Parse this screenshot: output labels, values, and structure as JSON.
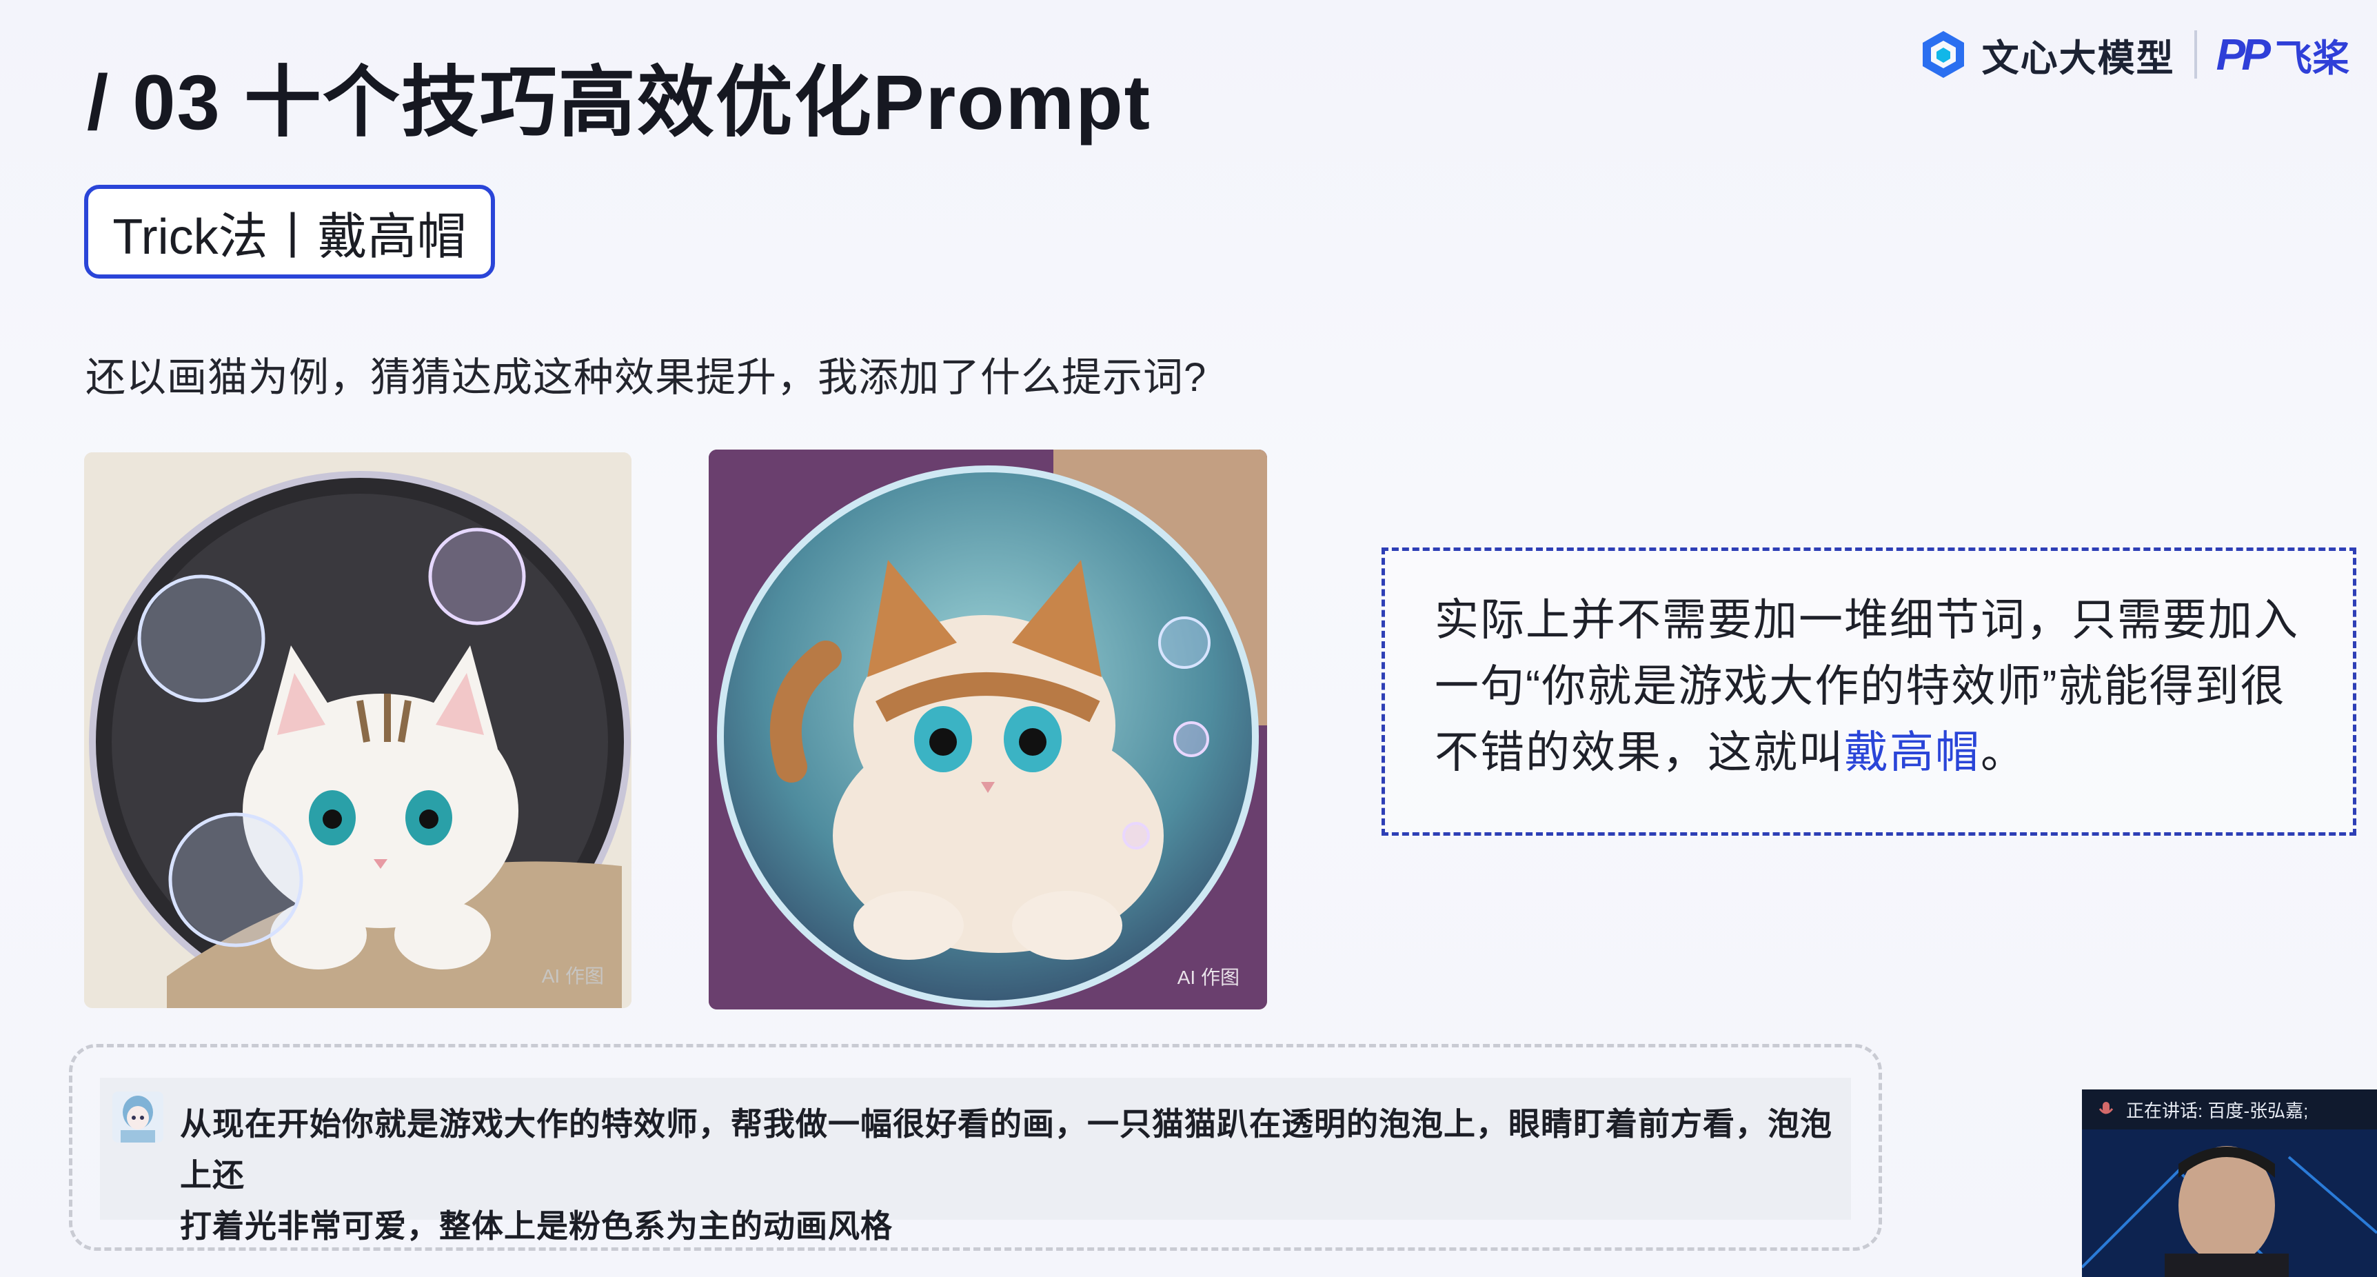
{
  "slide": {
    "title": "/ 03  十个技巧高效优化Prompt",
    "tag": "Trick法丨戴高帽",
    "question": "还以画猫为例，猜猜达成这种效果提升，我添加了什么提示词?"
  },
  "logos": {
    "wenxin": "文心大模型",
    "paddle_mark": "PP",
    "paddle": "飞桨"
  },
  "images": {
    "left_watermark": "AI 作图",
    "right_watermark": "AI 作图"
  },
  "callout": {
    "text_before": "实际上并不需要加一堆细节词，只需要加入一句“你就是游戏大作的特效师”就能得到很不错的效果，这就叫",
    "highlight": "戴高帽",
    "text_after": "。"
  },
  "prompt": {
    "line1": "从现在开始你就是游戏大作的特效师，帮我做一幅很好看的画，一只猫猫趴在透明的泡泡上，眼睛盯着前方看，泡泡上还",
    "line2": "打着光非常可爱，整体上是粉色系为主的动画风格"
  },
  "video": {
    "status": "正在讲话: 百度-张弘嘉;"
  },
  "colors": {
    "accent_blue": "#2a45d8",
    "callout_border": "#2e3fb6"
  }
}
